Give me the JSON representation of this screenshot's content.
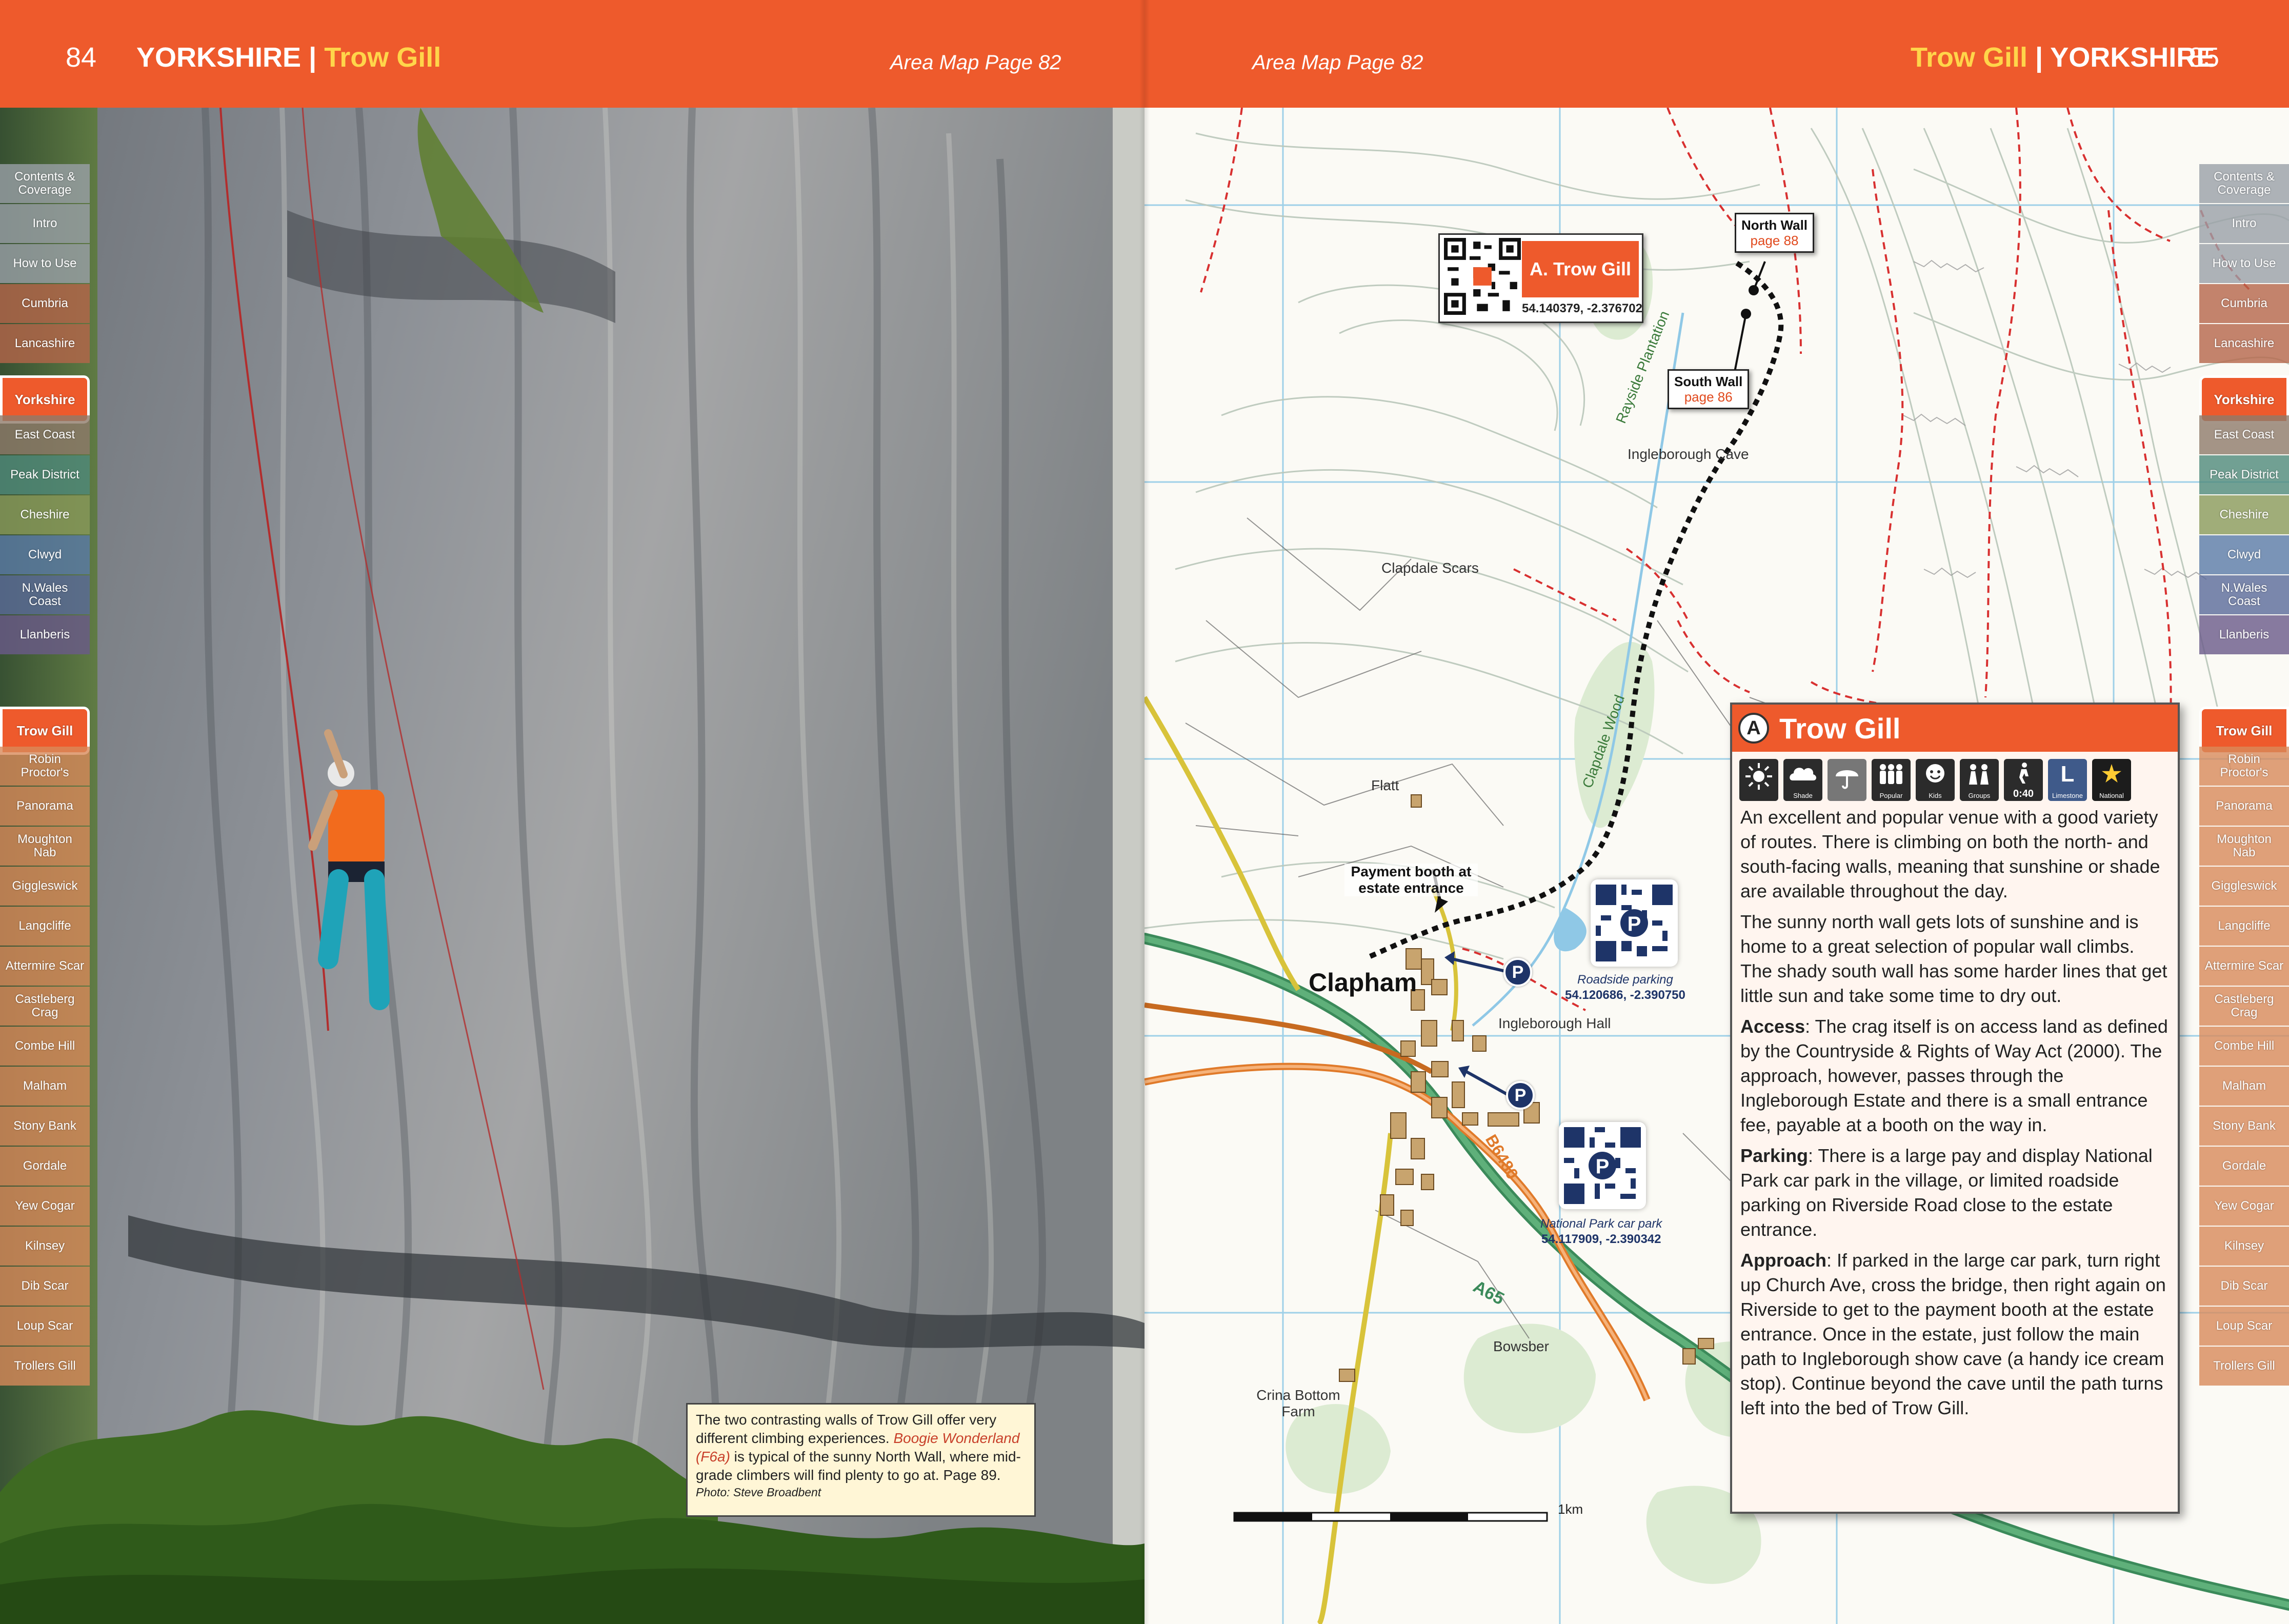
{
  "header_left": {
    "page_number": "84",
    "region": "YORKSHIRE",
    "separator": "|",
    "crag": "Trow Gill",
    "area_map": "Area Map Page 82"
  },
  "header_right": {
    "area_map": "Area Map Page 82",
    "crag": "Trow Gill",
    "separator": "|",
    "region": "YORKSHIRE",
    "page_number": "85"
  },
  "tabs": [
    "Contents & Coverage",
    "Intro",
    "How to Use",
    "Cumbria",
    "Lancashire",
    "Yorkshire",
    "East Coast",
    "Peak District",
    "Cheshire",
    "Clwyd",
    "N.Wales Coast",
    "Llanberis",
    "",
    "Trow Gill",
    "Robin Proctor's",
    "Panorama",
    "Moughton Nab",
    "Giggleswick",
    "Langcliffe",
    "Attermire Scar",
    "Castleberg Crag",
    "Combe Hill",
    "Malham",
    "Stony Bank",
    "Gordale",
    "Yew Cogar",
    "Kilnsey",
    "Dib Scar",
    "Loup Scar",
    "Trollers Gill"
  ],
  "tab_colors": [
    "#9aa0a8",
    "#9aa0a8",
    "#9aa0a8",
    "#b5654a",
    "#b5654a",
    "#ee5a2c",
    "#8f7a6a",
    "#4f8a7a",
    "#8a9a5a",
    "#5a7aa8",
    "#5a6a9a",
    "#6a5a8a",
    "#ffffff",
    "#ee5a2c",
    "#d88a5a",
    "#d88a5a",
    "#d88a5a",
    "#d88a5a",
    "#d88a5a",
    "#d88a5a",
    "#d88a5a",
    "#d88a5a",
    "#d88a5a",
    "#d88a5a",
    "#d88a5a",
    "#d88a5a",
    "#d88a5a",
    "#d88a5a",
    "#d88a5a",
    "#d88a5a"
  ],
  "caption": {
    "text_1": "The two contrasting walls of Trow Gill offer very different climbing experiences. ",
    "route": "Boogie Wonderland (F6a)",
    "text_2": " is typical of the sunny North Wall, where mid-grade climbers will find plenty to go at. Page 89.",
    "credit": "Photo: Steve Broadbent"
  },
  "map": {
    "crag_tag": {
      "name": "A. Trow Gill",
      "coords": "54.140379, -2.376702"
    },
    "north_wall": {
      "name": "North Wall",
      "page": "page 88"
    },
    "south_wall": {
      "name": "South Wall",
      "page": "page 86"
    },
    "payment_booth": "Payment booth at estate entrance",
    "roadside_parking": {
      "label": "Roadside parking",
      "coords": "54.120686, -2.390750"
    },
    "national_park_parking": {
      "label": "National Park car park",
      "coords": "54.117909, -2.390342"
    },
    "place_labels": {
      "rayside": "Rayside Plantation",
      "ingleborough_cave": "Ingleborough Cave",
      "clapdale_scars": "Clapdale Scars",
      "clapdale_wood": "Clapdale Wood",
      "flatt": "Flatt",
      "clapham": "Clapham",
      "ingleborough_hall": "Ingleborough Hall",
      "b6480": "B6480",
      "a65": "A65",
      "bowsber": "Bowsber",
      "crina": "Crina Bottom Farm"
    },
    "scale": "1km",
    "parking_symbol": "P",
    "parking_color": "#1e3468"
  },
  "info": {
    "badge": "A",
    "title": "Trow Gill",
    "icons": [
      {
        "name": "sun-icon",
        "caption": ""
      },
      {
        "name": "shade-icon",
        "caption": "Shade"
      },
      {
        "name": "rain-icon",
        "caption": ""
      },
      {
        "name": "popular-icon",
        "caption": "Popular"
      },
      {
        "name": "kids-icon",
        "caption": "Kids"
      },
      {
        "name": "groups-icon",
        "caption": "Groups"
      },
      {
        "name": "walk-time-icon",
        "caption": "0:40"
      },
      {
        "name": "limestone-icon",
        "caption": "Limestone",
        "glyph": "L"
      },
      {
        "name": "national-icon",
        "caption": "National",
        "glyph": "★"
      }
    ],
    "para1": "An excellent and popular venue with a good variety of routes. There is climbing on both the north- and south-facing walls, meaning that sunshine or shade are available throughout the day.",
    "para2": "The sunny north wall gets lots of sunshine and is home to a great selection of popular wall climbs. The shady south wall has some harder lines that get little sun and take some time to dry out.",
    "access_label": "Access",
    "access_text": ": The crag itself is on access land as defined by the Countryside & Rights of Way Act (2000). The approach, however, passes through the Ingleborough Estate and there is a small entrance fee, payable at a booth on the way in.",
    "parking_label": "Parking",
    "parking_text": ": There is a large pay and display National Park car park in the village, or limited roadside parking on Riverside Road close to the estate entrance.",
    "approach_label": "Approach",
    "approach_text": ": If parked in the large car park, turn right up Church Ave, cross the bridge, then right again on Riverside to get to the payment booth at the estate entrance. Once in the estate, just follow the main path to Ingleborough show cave (a handy ice cream stop). Continue beyond the cave until the path turns left into the bed of Trow Gill."
  }
}
